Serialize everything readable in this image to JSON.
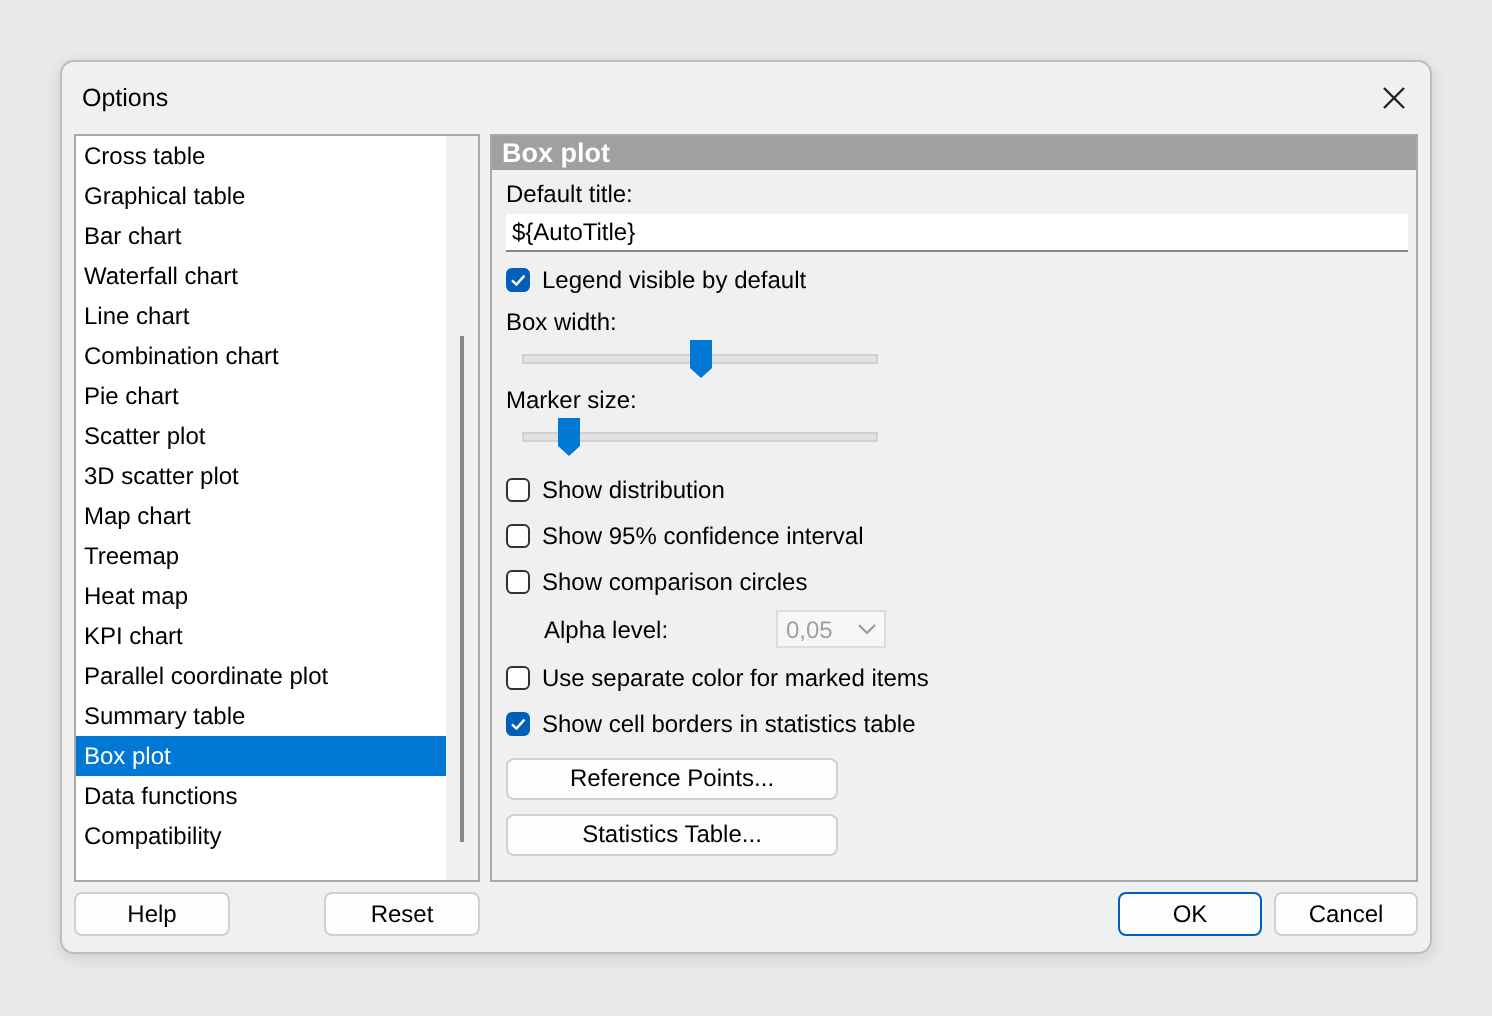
{
  "window": {
    "title": "Options"
  },
  "sidebar": {
    "items": [
      {
        "label": "Cross table",
        "selected": false
      },
      {
        "label": "Graphical table",
        "selected": false
      },
      {
        "label": "Bar chart",
        "selected": false
      },
      {
        "label": "Waterfall chart",
        "selected": false
      },
      {
        "label": "Line chart",
        "selected": false
      },
      {
        "label": "Combination chart",
        "selected": false
      },
      {
        "label": "Pie chart",
        "selected": false
      },
      {
        "label": "Scatter plot",
        "selected": false
      },
      {
        "label": "3D scatter plot",
        "selected": false
      },
      {
        "label": "Map chart",
        "selected": false
      },
      {
        "label": "Treemap",
        "selected": false
      },
      {
        "label": "Heat map",
        "selected": false
      },
      {
        "label": "KPI chart",
        "selected": false
      },
      {
        "label": "Parallel coordinate plot",
        "selected": false
      },
      {
        "label": "Summary table",
        "selected": false
      },
      {
        "label": "Box plot",
        "selected": true
      },
      {
        "label": "Data functions",
        "selected": false
      },
      {
        "label": "Compatibility",
        "selected": false
      }
    ]
  },
  "panel": {
    "title": "Box plot",
    "items": [
      {
        "kind": "field",
        "label": "Default title:",
        "value": "${AutoTitle}"
      },
      {
        "kind": "checkbox",
        "label": "Legend visible by default",
        "checked": true
      },
      {
        "kind": "slider",
        "label": "Box width:",
        "level": 0.5
      },
      {
        "kind": "slider",
        "label": "Marker size:",
        "level": 0.125
      },
      {
        "kind": "checkbox",
        "label": "Show distribution",
        "checked": false
      },
      {
        "kind": "checkbox",
        "label": "Show 95% confidence interval",
        "checked": false
      },
      {
        "kind": "checkbox",
        "label": "Show comparison circles",
        "checked": false
      },
      {
        "kind": "dropdown",
        "label": "Alpha level:",
        "value": "0,05",
        "disabled": true
      },
      {
        "kind": "checkbox",
        "label": "Use separate color for marked items",
        "checked": false
      },
      {
        "kind": "checkbox",
        "label": "Show cell borders in statistics table",
        "checked": true
      },
      {
        "kind": "button",
        "label": "Reference Points..."
      },
      {
        "kind": "button",
        "label": "Statistics Table..."
      }
    ]
  },
  "left_buttons": [
    "Help",
    "Reset"
  ],
  "right_buttons": [
    {
      "label": "OK",
      "default": true
    },
    {
      "label": "Cancel",
      "default": false
    }
  ]
}
